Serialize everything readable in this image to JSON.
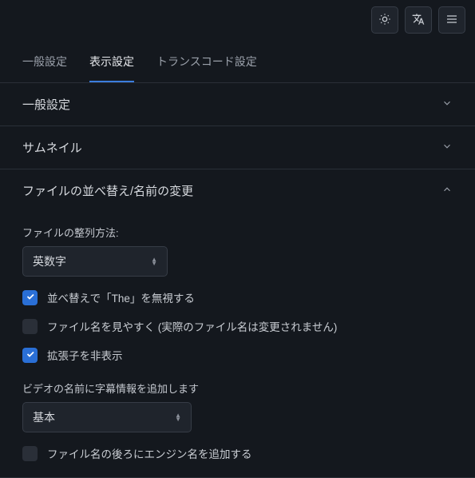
{
  "tabs": {
    "general": "一般設定",
    "display": "表示設定",
    "transcoding": "トランスコード設定"
  },
  "sections": {
    "general": "一般設定",
    "thumbnails": "サムネイル",
    "sortRename": "ファイルの並べ替え/名前の変更"
  },
  "sortRename": {
    "sortMethodLabel": "ファイルの整列方法:",
    "sortMethodValue": "英数字",
    "ignoreThe": "並べ替えで「The」を無視する",
    "prettify": "ファイル名を見やすく (実際のファイル名は変更されません)",
    "hideExt": "拡張子を非表示",
    "subtitleInfoLabel": "ビデオの名前に字幕情報を追加します",
    "subtitleInfoValue": "基本",
    "appendEngine": "ファイル名の後ろにエンジン名を追加する"
  }
}
